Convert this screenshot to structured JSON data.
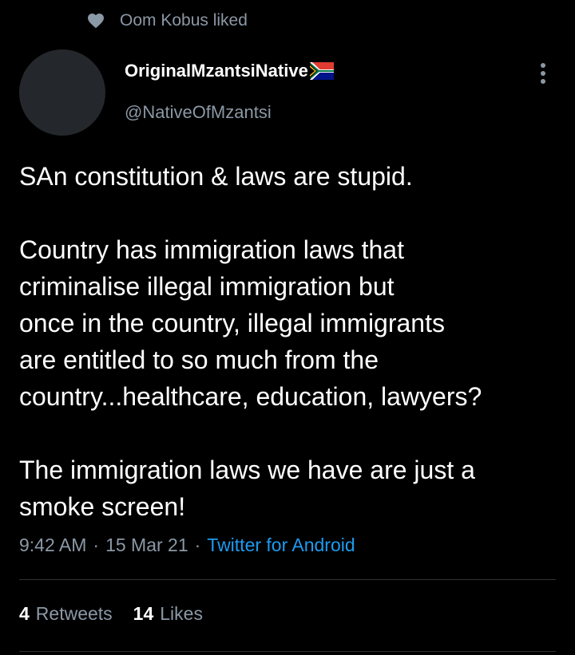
{
  "social_context": {
    "icon": "heart-icon",
    "text": "Oom Kobus liked"
  },
  "author": {
    "display_name": "OriginalMzantsiNative",
    "flag_icon": "south-africa-flag-icon",
    "handle": "@NativeOfMzantsi"
  },
  "tweet": {
    "paragraphs": [
      "SAn constitution & laws are stupid.",
      "Country has immigration laws that\ncriminalise illegal immigration but\nonce in the country, illegal immigrants\nare entitled to so much from the\ncountry...healthcare, education, lawyers?",
      "The immigration laws we have are just a\nsmoke screen!"
    ],
    "time": "9:42 AM",
    "separator": "·",
    "date": "15 Mar 21",
    "source": "Twitter for Android"
  },
  "stats": {
    "retweets_count": "4",
    "retweets_label": "Retweets",
    "likes_count": "14",
    "likes_label": "Likes"
  },
  "colors": {
    "background": "#000000",
    "primary_text": "#ffffff",
    "secondary_text": "#8b98a5",
    "link": "#1d9bf0",
    "divider": "#2f3336",
    "avatar_placeholder": "#24282c"
  }
}
